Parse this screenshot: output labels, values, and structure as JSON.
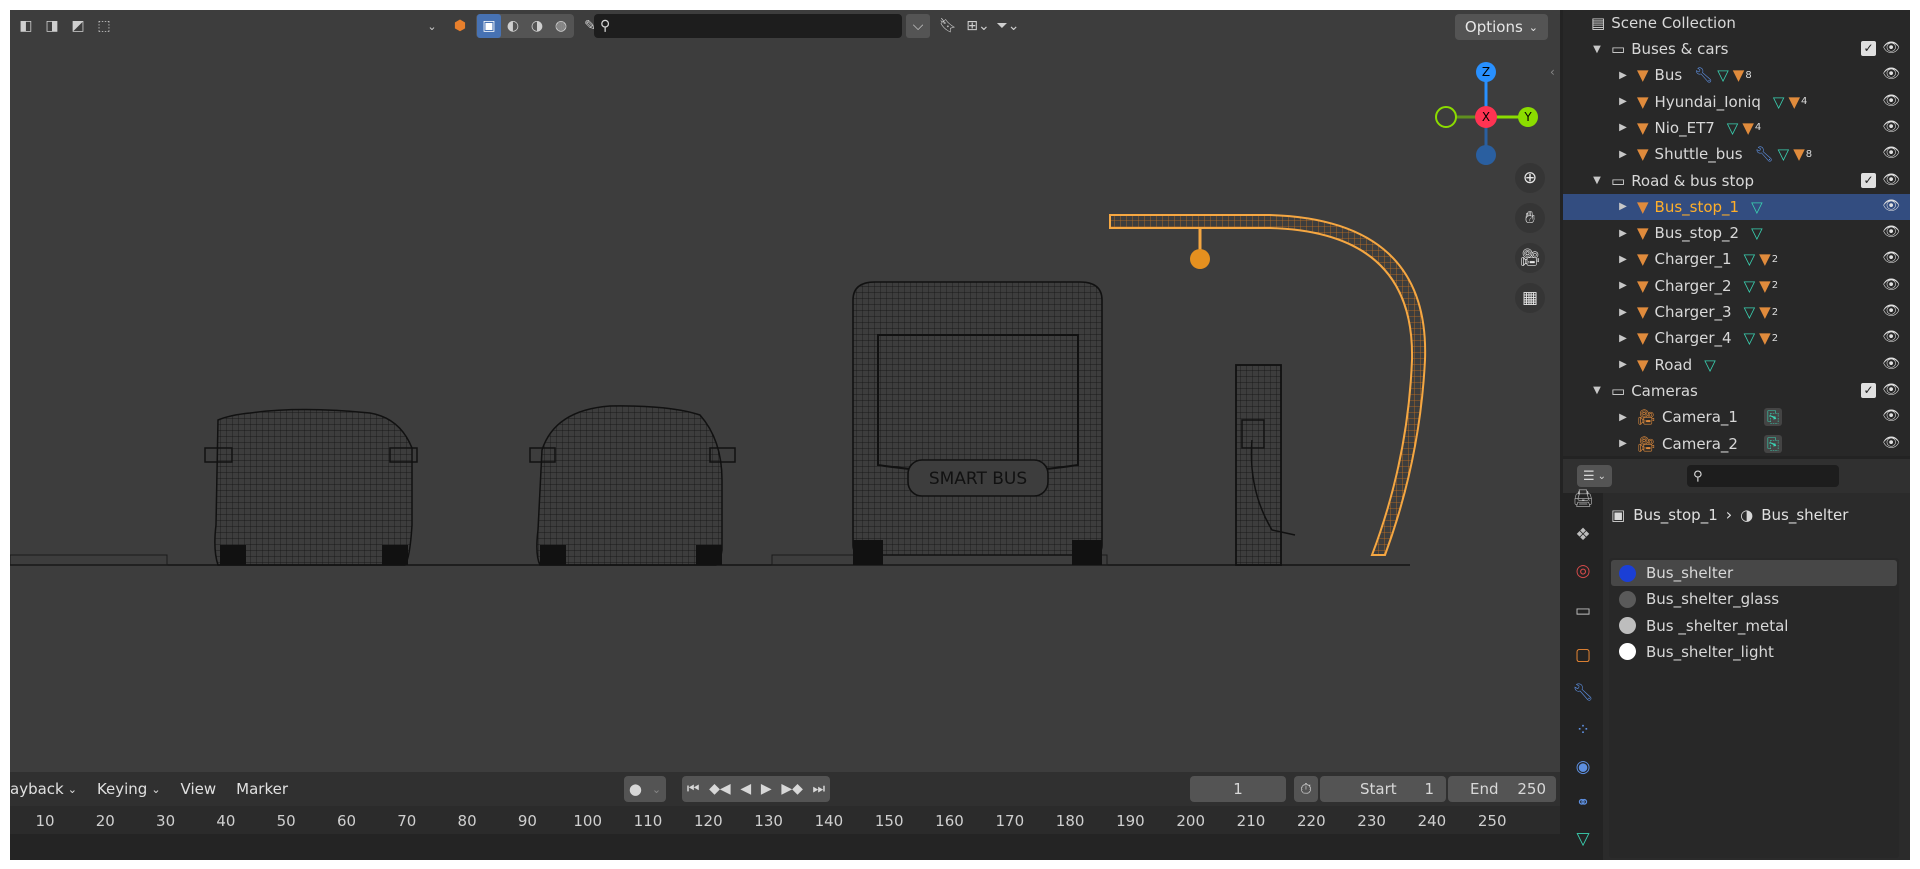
{
  "viewport": {
    "search_placeholder": "",
    "options_label": "Options",
    "bus_sign_text": "SMART BUS",
    "gizmo": {
      "z": "Z",
      "x": "X",
      "y": "Y"
    }
  },
  "timeline": {
    "menus": [
      "ayback",
      "Keying",
      "View",
      "Marker"
    ],
    "current_frame": "1",
    "start_label": "Start",
    "start_value": "1",
    "end_label": "End",
    "end_value": "250",
    "ruler": [
      "10",
      "20",
      "30",
      "40",
      "50",
      "60",
      "70",
      "80",
      "90",
      "100",
      "110",
      "120",
      "130",
      "140",
      "150",
      "160",
      "170",
      "180",
      "190",
      "200",
      "210",
      "220",
      "230",
      "240",
      "250"
    ]
  },
  "outliner": {
    "root": "Scene Collection",
    "rows": [
      {
        "label": "Buses & cars",
        "kind": "collection"
      },
      {
        "label": "Bus",
        "kind": "object",
        "mods": "wrench+mesh+mat",
        "mat_count": "8"
      },
      {
        "label": "Hyundai_Ioniq",
        "kind": "object",
        "mods": "mesh+mat",
        "mat_count": "4"
      },
      {
        "label": "Nio_ET7",
        "kind": "object",
        "mods": "mesh+mat",
        "mat_count": "4"
      },
      {
        "label": "Shuttle_bus",
        "kind": "object",
        "mods": "wrench+mesh+mat",
        "mat_count": "8"
      },
      {
        "label": "Road & bus stop",
        "kind": "collection"
      },
      {
        "label": "Bus_stop_1",
        "kind": "object",
        "mods": "mesh",
        "selected": true
      },
      {
        "label": "Bus_stop_2",
        "kind": "object",
        "mods": "mesh"
      },
      {
        "label": "Charger_1",
        "kind": "object",
        "mods": "mesh+mat",
        "mat_count": "2"
      },
      {
        "label": "Charger_2",
        "kind": "object",
        "mods": "mesh+mat",
        "mat_count": "2"
      },
      {
        "label": "Charger_3",
        "kind": "object",
        "mods": "mesh+mat",
        "mat_count": "2"
      },
      {
        "label": "Charger_4",
        "kind": "object",
        "mods": "mesh+mat",
        "mat_count": "2"
      },
      {
        "label": "Road",
        "kind": "object",
        "mods": "mesh"
      },
      {
        "label": "Cameras",
        "kind": "collection"
      },
      {
        "label": "Camera_1",
        "kind": "camera"
      },
      {
        "label": "Camera_2",
        "kind": "camera"
      }
    ]
  },
  "properties": {
    "search_placeholder": "",
    "breadcrumb_object": "Bus_stop_1",
    "breadcrumb_material": "Bus_shelter",
    "materials": [
      {
        "label": "Bus_shelter",
        "color": "#1b3fd6",
        "selected": true
      },
      {
        "label": "Bus_shelter_glass",
        "color": "#5a5a5a"
      },
      {
        "label": "Bus _shelter_metal",
        "color": "#bdbdbd"
      },
      {
        "label": "Bus_shelter_light",
        "color": "#ffffff"
      }
    ]
  },
  "colors": {
    "selection_orange": "#f5a742",
    "axis_x": "#ff3352",
    "axis_y": "#8bdc00",
    "axis_z": "#2890ff",
    "object_icon": "#e08b3c",
    "mesh_icon": "#3ad1b1"
  }
}
